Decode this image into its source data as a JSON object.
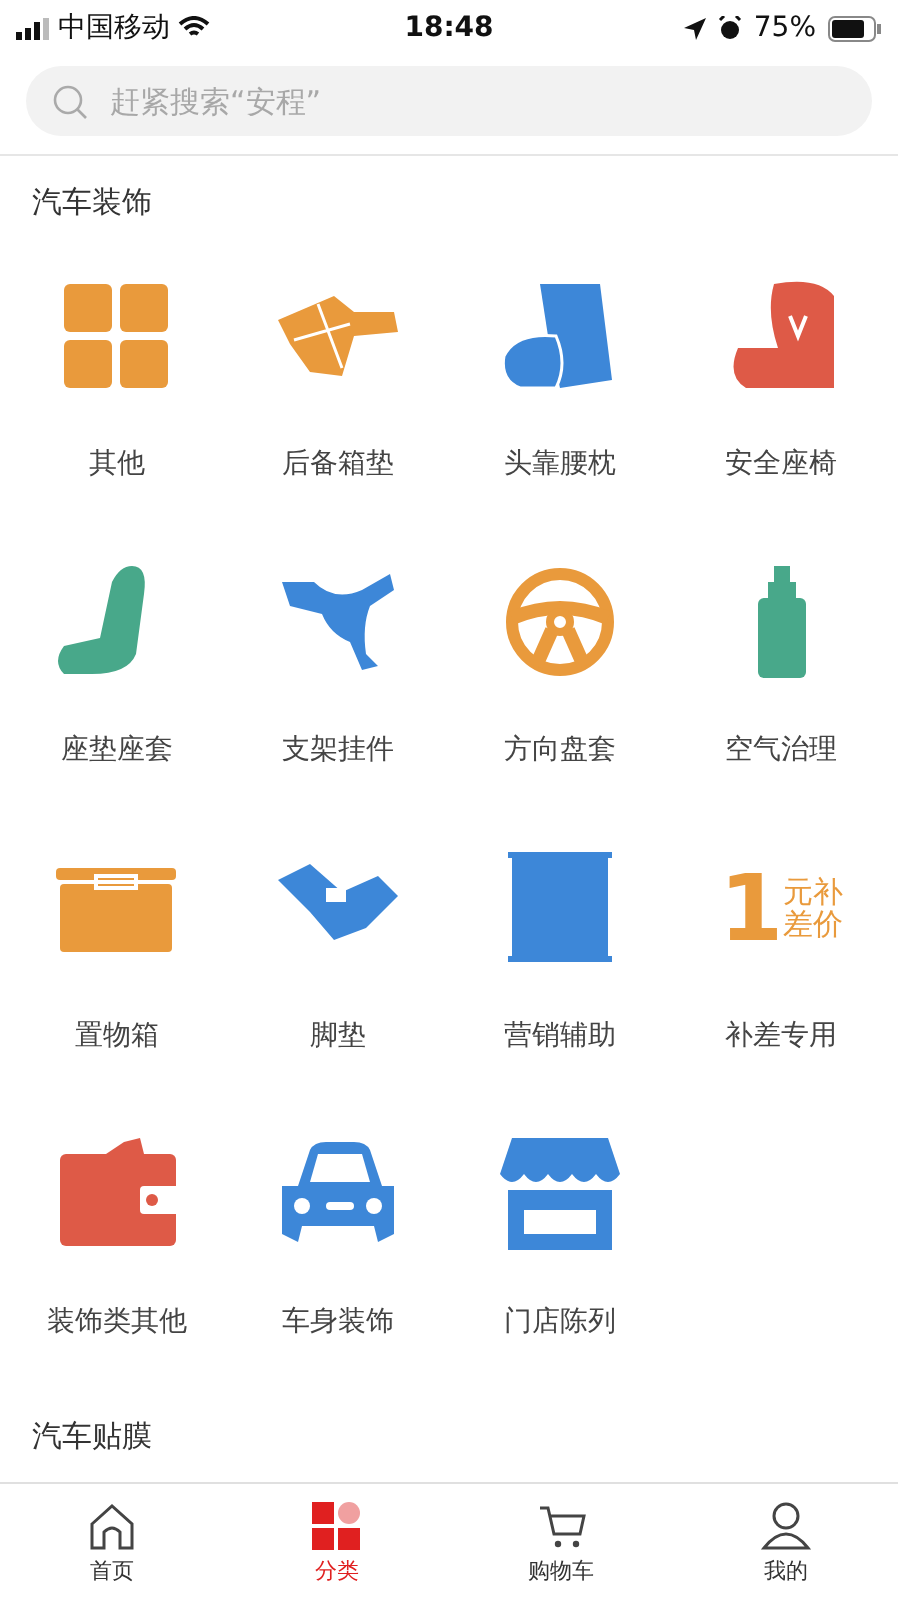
{
  "status_bar": {
    "carrier": "中国移动",
    "time": "18:48",
    "battery": "75%"
  },
  "search": {
    "placeholder": "赶紧搜索“安程”"
  },
  "sections": [
    {
      "title": "汽车装饰",
      "items": [
        {
          "label": "其他"
        },
        {
          "label": "后备箱垫"
        },
        {
          "label": "头靠腰枕"
        },
        {
          "label": "安全座椅"
        },
        {
          "label": "座垫座套"
        },
        {
          "label": "支架挂件"
        },
        {
          "label": "方向盘套"
        },
        {
          "label": "空气治理"
        },
        {
          "label": "置物箱"
        },
        {
          "label": "脚垫"
        },
        {
          "label": "营销辅助"
        },
        {
          "label": "补差专用",
          "badge": [
            "1",
            "元补",
            "差价"
          ]
        },
        {
          "label": "装饰类其他"
        },
        {
          "label": "车身装饰"
        },
        {
          "label": "门店陈列"
        }
      ]
    },
    {
      "title": "汽车贴膜"
    }
  ],
  "tabs": [
    {
      "label": "首页",
      "selected": false
    },
    {
      "label": "分类",
      "selected": true
    },
    {
      "label": "购物车",
      "selected": false
    },
    {
      "label": "我的",
      "selected": false
    }
  ]
}
